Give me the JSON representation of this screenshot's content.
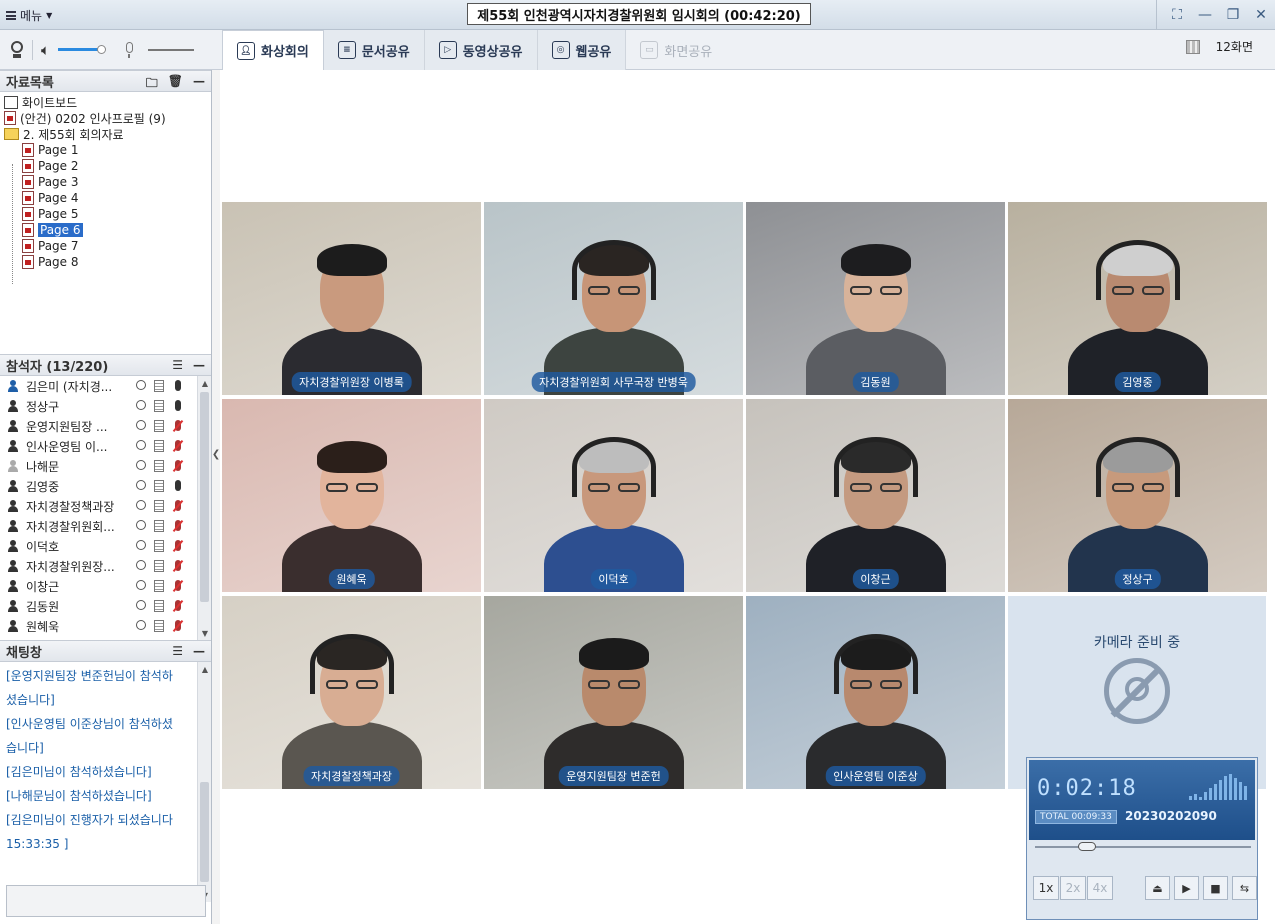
{
  "app": {
    "menu_label": "메뉴",
    "title": "제55회 인천광역시자치경찰위원회 임시회의 (00:42:20)"
  },
  "toolbar": {
    "tabs": [
      {
        "label": "화상회의",
        "icon": "person-icon",
        "state": "active"
      },
      {
        "label": "문서공유",
        "icon": "document-icon",
        "state": "normal"
      },
      {
        "label": "동영상공유",
        "icon": "play-icon",
        "state": "normal"
      },
      {
        "label": "웹공유",
        "icon": "globe-icon",
        "state": "normal"
      },
      {
        "label": "화면공유",
        "icon": "screen-icon",
        "state": "disabled"
      }
    ],
    "screen_count": "12화면",
    "speaker_volume": 0.95,
    "mic_volume": 0.0
  },
  "doc_panel": {
    "title": "자료목록",
    "items": [
      {
        "label": "화이트보드",
        "icon": "whiteboard-icon"
      },
      {
        "label": "(안건) 0202 인사프로필 (9)",
        "icon": "pdf-icon"
      },
      {
        "label": "2. 제55회 회의자료",
        "icon": "folder-icon"
      }
    ],
    "pages": [
      "Page 1",
      "Page 2",
      "Page 3",
      "Page 4",
      "Page 5",
      "Page 6",
      "Page 7",
      "Page 8"
    ],
    "selected_page": "Page 6"
  },
  "participants": {
    "title": "참석자 (13/220)",
    "rows": [
      {
        "name": "김은미 (자치경...",
        "role": "host",
        "mic": "on"
      },
      {
        "name": "정상구",
        "role": "user",
        "mic": "on"
      },
      {
        "name": "운영지원팀장 ...",
        "role": "user",
        "mic": "off"
      },
      {
        "name": "인사운영팀 이...",
        "role": "user",
        "mic": "off"
      },
      {
        "name": "나해문",
        "role": "grey",
        "mic": "off"
      },
      {
        "name": "김영중",
        "role": "user",
        "mic": "on"
      },
      {
        "name": "자치경찰정책과장",
        "role": "user",
        "mic": "off"
      },
      {
        "name": "자치경찰위원회...",
        "role": "user",
        "mic": "off"
      },
      {
        "name": "이덕호",
        "role": "user",
        "mic": "off"
      },
      {
        "name": "자치경찰위원장...",
        "role": "user",
        "mic": "off"
      },
      {
        "name": "이창근",
        "role": "user",
        "mic": "off"
      },
      {
        "name": "김동원",
        "role": "user",
        "mic": "off"
      },
      {
        "name": "원혜욱",
        "role": "user",
        "mic": "off"
      }
    ]
  },
  "chat": {
    "title": "채팅창",
    "lines": [
      "[운영지원팀장 변준헌님이 참석하",
      "셨습니다]",
      "[인사운영팀 이준상님이 참석하셨",
      "습니다]",
      "[김은미님이 참석하셨습니다]",
      "[나해문님이 참석하셨습니다]",
      "[김은미님이 진행자가 되셨습니다",
      "15:33:35 ]"
    ],
    "input_value": ""
  },
  "video_tiles": [
    {
      "label": "자치경찰위원장 이병록",
      "bg": "#c9c2b4",
      "body": "#2b2b30",
      "hair": "#1c1c1c",
      "skin": "#c99a7e",
      "headset": false,
      "glasses": false
    },
    {
      "label": "자치경찰위원회 사무국장 반병욱",
      "bg": "#b9c4c8",
      "body": "#3d4440",
      "hair": "#2a2522",
      "skin": "#c79577",
      "headset": true,
      "glasses": true
    },
    {
      "label": "김동원",
      "bg": "#8e9094",
      "body": "#5b5d62",
      "hair": "#1d1d1f",
      "skin": "#d8b39a",
      "headset": false,
      "glasses": true
    },
    {
      "label": "김영중",
      "bg": "#b8b09f",
      "body": "#1f2228",
      "hair": "#cfcfcf",
      "skin": "#b98a70",
      "headset": true,
      "glasses": true
    },
    {
      "label": "원혜욱",
      "bg": "#d9b8b0",
      "body": "#3a2e2e",
      "hair": "#2b1f1a",
      "skin": "#e2b49c",
      "headset": false,
      "glasses": true
    },
    {
      "label": "이덕호",
      "bg": "#cfcac4",
      "body": "#2d4f90",
      "hair": "#bdbdbd",
      "skin": "#c8987c",
      "headset": true,
      "glasses": true
    },
    {
      "label": "이창근",
      "bg": "#c6c2bc",
      "body": "#1f2127",
      "hair": "#2a2a2a",
      "skin": "#c49a80",
      "headset": true,
      "glasses": true
    },
    {
      "label": "정상구",
      "bg": "#b7a898",
      "body": "#22344d",
      "hair": "#9b9b9b",
      "skin": "#c79a7c",
      "headset": true,
      "glasses": true
    },
    {
      "label": "자치경찰정책과장",
      "bg": "#d6d0c5",
      "body": "#5a5650",
      "hair": "#2a2623",
      "skin": "#d8ad93",
      "headset": true,
      "glasses": true
    },
    {
      "label": "운영지원팀장 변준헌",
      "bg": "#a6a79f",
      "body": "#2e2c2b",
      "hair": "#1b1b1b",
      "skin": "#b98a6c",
      "headset": false,
      "glasses": true
    },
    {
      "label": "인사운영팀 이준상",
      "bg": "#9eb0c0",
      "body": "#2a2b2d",
      "hair": "#1c1c1c",
      "skin": "#b8896e",
      "headset": true,
      "glasses": true
    }
  ],
  "camera_placeholder": {
    "text": "카메라 준비 중"
  },
  "recorder": {
    "time": "0:02:18",
    "total_label": "TOTAL",
    "total_time": "00:09:33",
    "session_id": "20230202090",
    "seek_fraction": 0.24,
    "speeds": [
      "1x",
      "2x",
      "4x"
    ],
    "active_speed": "1x"
  }
}
